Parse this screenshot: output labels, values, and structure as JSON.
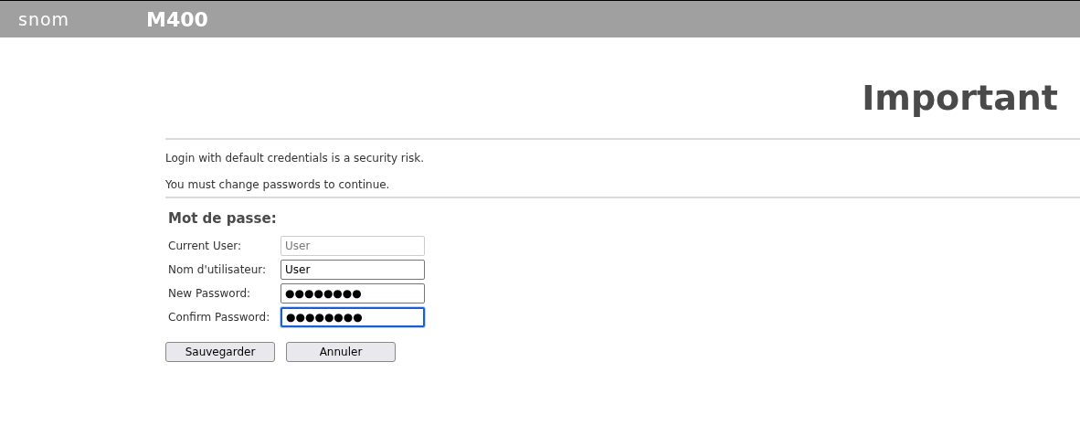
{
  "header": {
    "brand": "snom",
    "model": "M400"
  },
  "title": "Important",
  "messages": [
    "Login with default credentials is a security risk.",
    "You must change passwords to continue."
  ],
  "section_title": "Mot de passe:",
  "fields": [
    {
      "label": "Current User:",
      "value": "User",
      "disabled": true,
      "focused": false
    },
    {
      "label": "Nom d'utilisateur:",
      "value": "User",
      "disabled": false,
      "focused": false
    },
    {
      "label": "New Password:",
      "value": "●●●●●●●●",
      "disabled": false,
      "focused": false
    },
    {
      "label": "Confirm Password:",
      "value": "●●●●●●●●",
      "disabled": false,
      "focused": true
    }
  ],
  "buttons": [
    "Sauvegarder",
    "Annuler"
  ]
}
